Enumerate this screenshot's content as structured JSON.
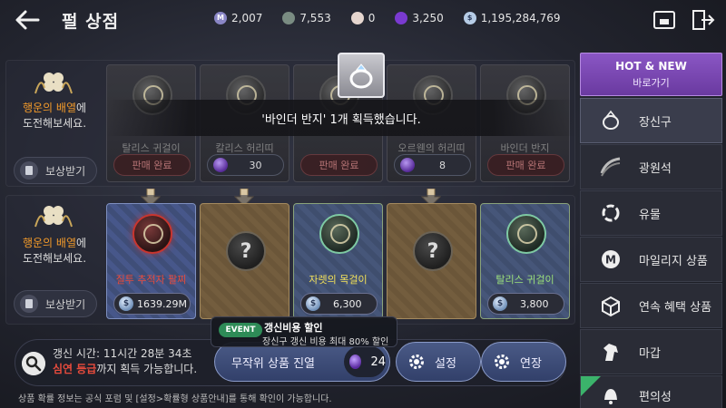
{
  "header": {
    "title": "펄 상점",
    "currencies": [
      {
        "icon": "mileage-coin-icon",
        "letter": "M",
        "value": "2,007",
        "color": "#8a86c6"
      },
      {
        "icon": "stone-icon",
        "letter": "",
        "value": "7,553",
        "color": "#7a8c82"
      },
      {
        "icon": "pearl-icon",
        "letter": "",
        "value": "0",
        "color": "#e6d6cf"
      },
      {
        "icon": "purple-pearl-icon",
        "letter": "",
        "value": "3,250",
        "color": "#7a3ad0"
      },
      {
        "icon": "silver-icon",
        "letter": "$",
        "value": "1,195,284,769",
        "color": "#b6cce6"
      }
    ]
  },
  "toast": {
    "message": "'바인더 반지' 1개 획득했습니다."
  },
  "row1": {
    "info_highlight": "행운의 배열",
    "info_suffix": "에",
    "info_line2": "도전해보세요.",
    "reward_label": "보상받기",
    "cards": [
      {
        "name": "탈리스 귀걸이",
        "status": "판매 완료"
      },
      {
        "name": "칼리스 허리띠",
        "price": "30"
      },
      {
        "name": "",
        "status": "판매 완료"
      },
      {
        "name": "오르웬의 허리띠",
        "price": "8"
      },
      {
        "name": "바인더 반지",
        "status": "판매 완료"
      }
    ]
  },
  "row2": {
    "info_highlight": "행운의 배열",
    "info_suffix": "에",
    "info_line2": "도전해보세요.",
    "reward_label": "보상받기",
    "cards": [
      {
        "name": "질투 추적자 팔찌",
        "price": "1639.29M",
        "style": "blue",
        "name_color": "#e84b3c"
      },
      {
        "name": "?",
        "style": "brown"
      },
      {
        "name": "자렛의 목걸이",
        "price": "6,300",
        "style": "green",
        "name_color": "#f2e05a"
      },
      {
        "name": "?",
        "style": "brown"
      },
      {
        "name": "탈리스 귀걸이",
        "price": "3,800",
        "style": "green",
        "name_color": "#9be07a"
      }
    ]
  },
  "bottom": {
    "renew_prefix": "갱신 시간: ",
    "renew_time": "11시간 28분 34초",
    "grade_highlight": "심연 등급",
    "grade_suffix": "까지 획득 가능합니다.",
    "random_label": "무작위 상품 진열",
    "random_cost": "24",
    "settings_label": "설정",
    "extend_label": "연장",
    "event_badge": "EVENT",
    "event_title": "갱신비용 할인",
    "event_sub": "장신구 갱신 비용 최대 80% 할인",
    "footnote": "상품 확률 정보는 공식 포럼 및 [설정>확률형 상품안내]를 통해 확인이 가능합니다."
  },
  "sidebar": {
    "hot_title": "HOT & NEW",
    "hot_sub": "바로가기",
    "items": [
      {
        "label": "장신구",
        "icon": "ring-icon"
      },
      {
        "label": "광원석",
        "icon": "gem-icon"
      },
      {
        "label": "유물",
        "icon": "relic-icon"
      },
      {
        "label": "마일리지 상품",
        "icon": "mileage-icon"
      },
      {
        "label": "연속 혜택 상품",
        "icon": "box-icon"
      },
      {
        "label": "마갑",
        "icon": "horse-icon"
      },
      {
        "label": "편의성",
        "icon": "bell-icon"
      }
    ]
  }
}
